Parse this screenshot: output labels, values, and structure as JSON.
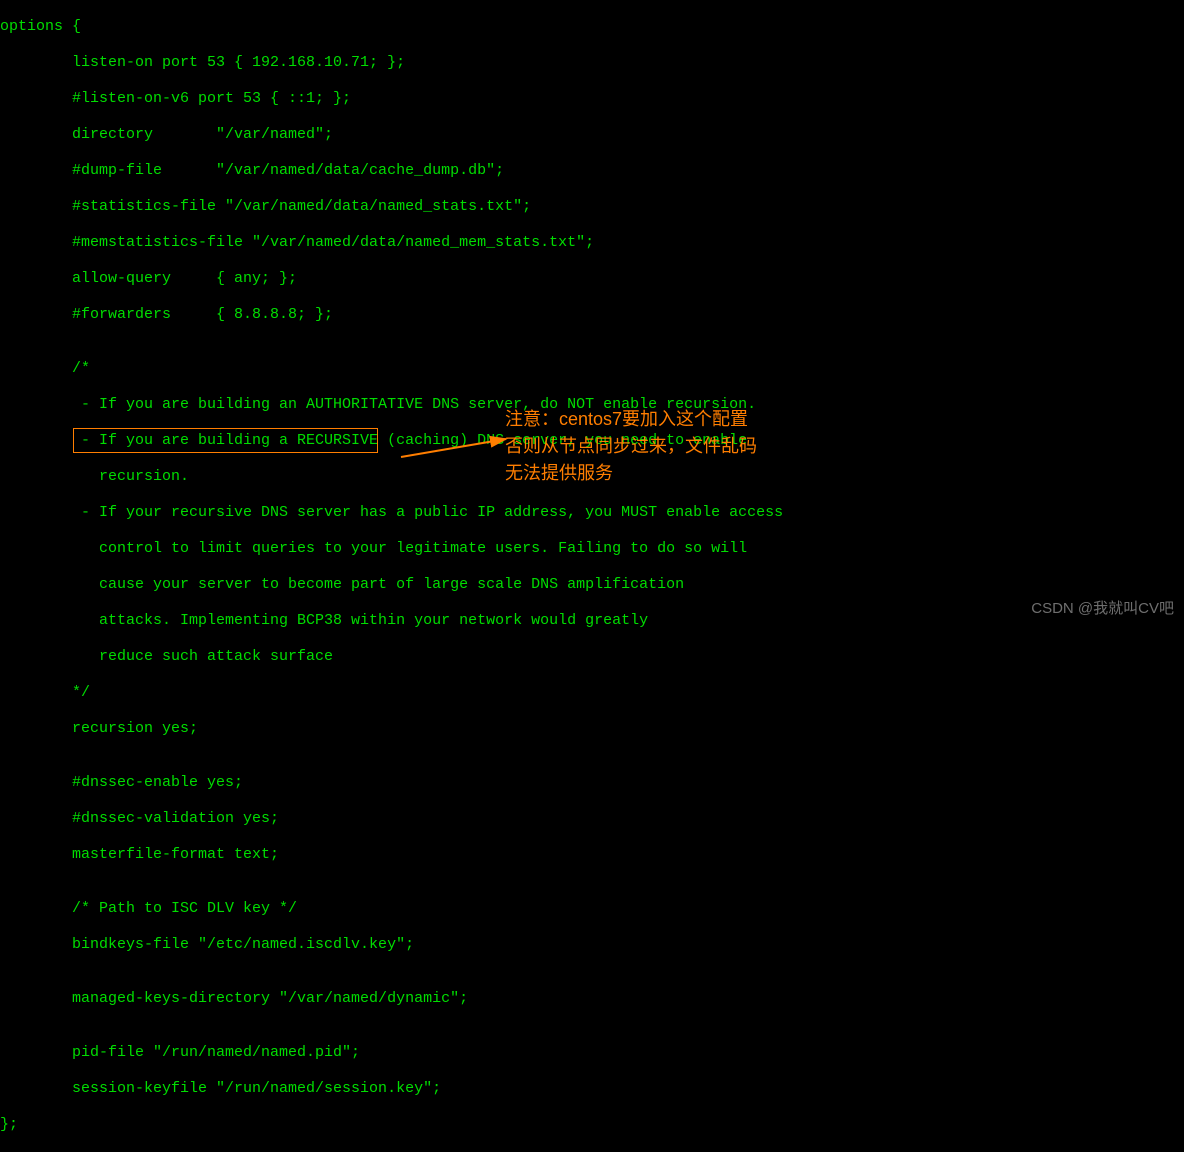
{
  "code": {
    "l1": "options {",
    "l2": "        listen-on port 53 { 192.168.10.71; };",
    "l3": "        #listen-on-v6 port 53 { ::1; };",
    "l4": "        directory       \"/var/named\";",
    "l5": "        #dump-file      \"/var/named/data/cache_dump.db\";",
    "l6": "        #statistics-file \"/var/named/data/named_stats.txt\";",
    "l7": "        #memstatistics-file \"/var/named/data/named_mem_stats.txt\";",
    "l8": "        allow-query     { any; };",
    "l9": "        #forwarders     { 8.8.8.8; };",
    "l10": "",
    "l11": "        /*",
    "l12": "         - If you are building an AUTHORITATIVE DNS server, do NOT enable recursion.",
    "l13": "         - If you are building a RECURSIVE (caching) DNS server, you need to enable",
    "l14": "           recursion.",
    "l15": "         - If your recursive DNS server has a public IP address, you MUST enable access",
    "l16": "           control to limit queries to your legitimate users. Failing to do so will",
    "l17": "           cause your server to become part of large scale DNS amplification",
    "l18": "           attacks. Implementing BCP38 within your network would greatly",
    "l19": "           reduce such attack surface",
    "l20": "        */",
    "l21": "        recursion yes;",
    "l22": "",
    "l23": "        #dnssec-enable yes;",
    "l24": "        #dnssec-validation yes;",
    "l25": "        masterfile-format text;",
    "l26": "",
    "l27": "        /* Path to ISC DLV key */",
    "l28": "        bindkeys-file \"/etc/named.iscdlv.key\";",
    "l29": "",
    "l30": "        managed-keys-directory \"/var/named/dynamic\";",
    "l31": "",
    "l32": "        pid-file \"/run/named/named.pid\";",
    "l33": "        session-keyfile \"/run/named/session.key\";",
    "l34": "};"
  },
  "annotation": {
    "line1": "注意：centos7要加入这个配置",
    "line2": "否则从节点同步过来，文件乱码",
    "line3": "无法提供服务"
  },
  "watermark": "CSDN @我就叫CV吧"
}
